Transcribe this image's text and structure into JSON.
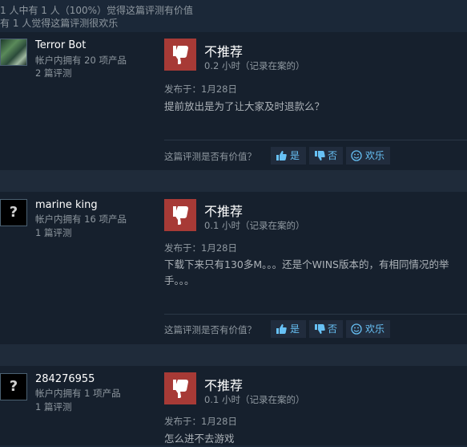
{
  "summary": {
    "line1": "1 人中有 1 人（100%）觉得这篇评测有价值",
    "line2": "有 1 人觉得这篇评测很欢乐"
  },
  "common": {
    "recommendation": "不推荐",
    "helpful_question": "这篇评测是否有价值？",
    "btn_yes": "是",
    "btn_no": "否",
    "btn_funny": "欢乐"
  },
  "reviews": [
    {
      "username": "Terror Bot",
      "products_owned": "帐户内拥有 20 项产品",
      "review_count": "2 篇评测",
      "hours": "0.2 小时（记录在案的）",
      "posted": "发布于：1月28日",
      "body_lines": [
        "提前放出是为了让大家及时退款么？"
      ]
    },
    {
      "username": "marine king",
      "avatar_glyph": "?",
      "products_owned": "帐户内拥有 16 项产品",
      "review_count": "1 篇评测",
      "hours": "0.1 小时（记录在案的）",
      "posted": "发布于：1月28日",
      "body_lines": [
        "下载下来只有130多M。。。还是个WINS版本的，有相同情况的举",
        "手。。。"
      ]
    },
    {
      "username": "284276955",
      "avatar_glyph": "?",
      "products_owned": "帐户内拥有 1 项产品",
      "review_count": "1 篇评测",
      "hours": "0.1 小时（记录在案的）",
      "posted": "发布于：1月28日",
      "body_lines": [
        "怎么进不去游戏"
      ]
    }
  ],
  "colors": {
    "page_bg": "#1b2838",
    "review_bg": "#16202d",
    "thumb_down_bg": "#a73a36",
    "link_blue": "#67c1f5"
  }
}
